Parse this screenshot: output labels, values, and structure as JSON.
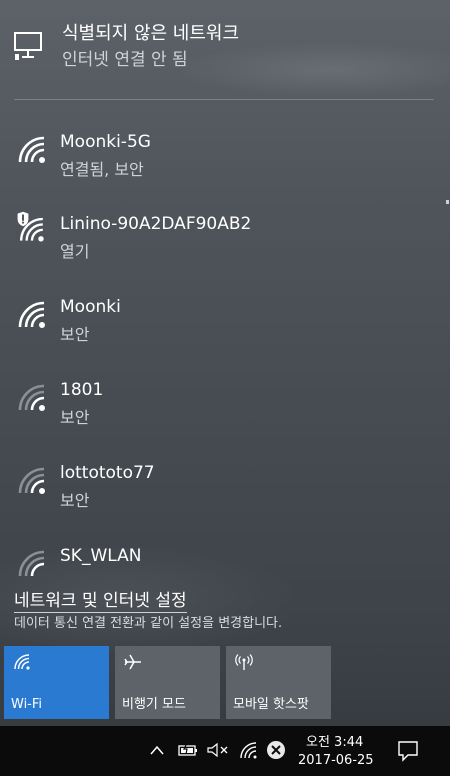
{
  "header": {
    "name": "식별되지 않은 네트워크",
    "status": "인터넷 연결 안 됨"
  },
  "networks": [
    {
      "name": "Moonki-5G",
      "status": "연결됨, 보안"
    },
    {
      "name": "Linino-90A2DAF90AB2",
      "status": "열기"
    },
    {
      "name": "Moonki",
      "status": "보안"
    },
    {
      "name": "1801",
      "status": "보안"
    },
    {
      "name": "lottototo77",
      "status": "보안"
    },
    {
      "name": "SK_WLAN",
      "status": ""
    }
  ],
  "settings": {
    "link_label": "네트워크 및 인터넷 설정",
    "description": "데이터 통신 연결 전환과 같이 설정을 변경합니다."
  },
  "quick_actions": [
    {
      "label": "Wi-Fi",
      "icon": "wifi-icon",
      "active": true
    },
    {
      "label": "비행기 모드",
      "icon": "airplane-icon",
      "active": false
    },
    {
      "label": "모바일 핫스팟",
      "icon": "hotspot-icon",
      "active": false
    }
  ],
  "taskbar": {
    "time": "오전 3:44",
    "date": "2017-06-25"
  },
  "colors": {
    "accent": "#2a7ad2",
    "tile": "#5e6369",
    "taskbar": "#0b0b0c"
  }
}
